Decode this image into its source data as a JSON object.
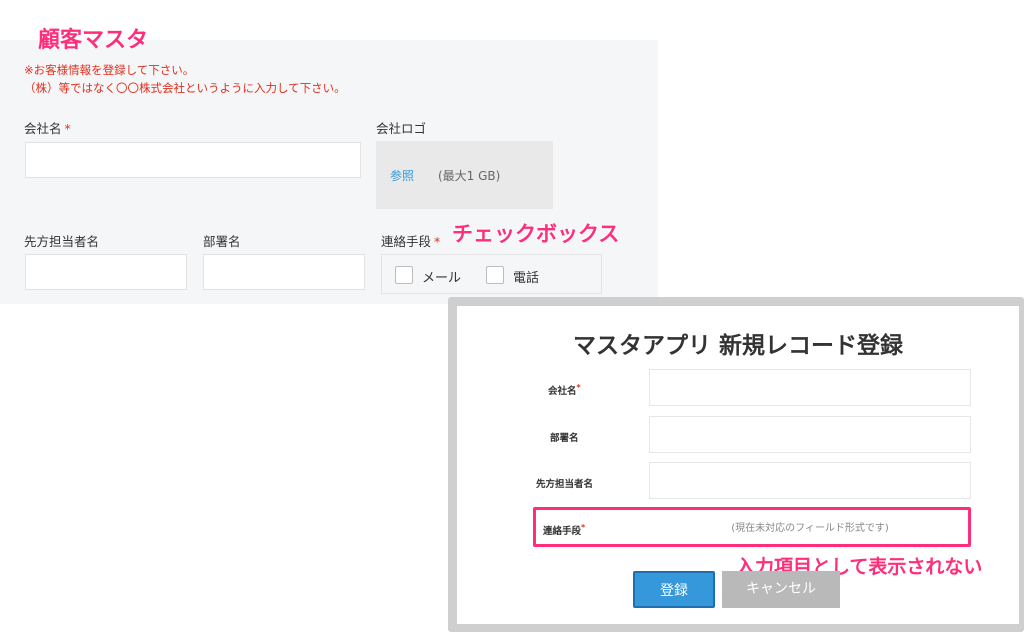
{
  "annotations": {
    "title": "顧客マスタ",
    "checkbox": "チェックボックス",
    "not_displayed": "入力項目として表示されない"
  },
  "form": {
    "notice_line1": "※お客様情報を登録して下さい。",
    "notice_line2": "（株）等ではなく〇〇株式会社というように入力して下さい。",
    "company_name_label": "会社名",
    "company_logo_label": "会社ロゴ",
    "browse_label": "参照",
    "max_size": "(最大1 GB)",
    "contact_person_label": "先方担当者名",
    "department_label": "部署名",
    "contact_method_label": "連絡手段",
    "required_mark": "*",
    "options": [
      "メール",
      "電話"
    ]
  },
  "dialog": {
    "title": "マスタアプリ 新規レコード登録",
    "company_label": "会社名",
    "department_label": "部署名",
    "contact_person_label": "先方担当者名",
    "contact_method_label": "連絡手段",
    "required_mark": "*",
    "unsupported_text": "(現在未対応のフィールド形式です)",
    "register_label": "登録",
    "cancel_label": "キャンセル"
  },
  "colors": {
    "annotation": "#ff2d7a",
    "required": "#e0301e",
    "primary": "#3498db",
    "cancel": "#b9b9b9"
  }
}
